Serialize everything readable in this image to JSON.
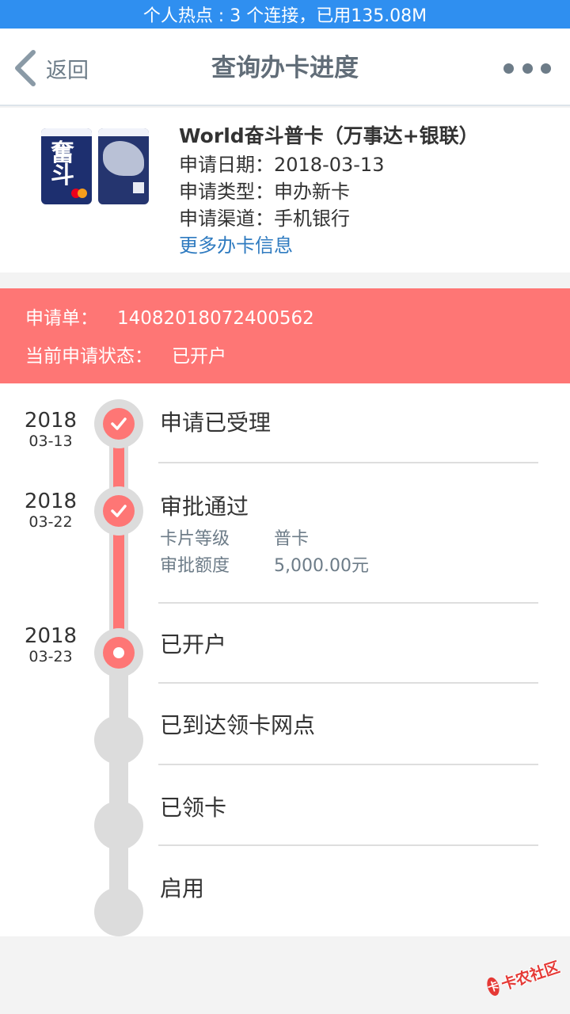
{
  "status_bar": {
    "text": "个人热点 : 3 个连接，已用135.08M"
  },
  "nav": {
    "back_label": "返回",
    "title": "查询办卡进度"
  },
  "card": {
    "name": "World奋斗普卡（万事达+银联）",
    "apply_date": "申请日期：2018-03-13",
    "apply_type": "申请类型：申办新卡",
    "apply_channel": "申请渠道：手机银行",
    "more_link": "更多办卡信息",
    "card_colors": {
      "primary": "#1d2f6f",
      "secondary": "#25356f"
    }
  },
  "application": {
    "number_label": "申请单：",
    "number_value": "14082018072400562",
    "status_label": "当前申请状态：",
    "status_value": "已开户"
  },
  "timeline": [
    {
      "year": "2018",
      "date": "03-13",
      "title": "申请已受理",
      "state": "done"
    },
    {
      "year": "2018",
      "date": "03-22",
      "title": "审批通过",
      "state": "done",
      "details": [
        {
          "label": "卡片等级",
          "value": "普卡"
        },
        {
          "label": "审批额度",
          "value": "5,000.00元"
        }
      ]
    },
    {
      "year": "2018",
      "date": "03-23",
      "title": "已开户",
      "state": "current"
    },
    {
      "title": "已到达领卡网点",
      "state": "pending"
    },
    {
      "title": "已领卡",
      "state": "pending"
    },
    {
      "title": "启用",
      "state": "pending"
    }
  ],
  "watermark": {
    "text": "卡农社区",
    "icon": "卡"
  },
  "colors": {
    "accent": "#fe7675",
    "status_bar": "#2f8ff0",
    "link": "#2f7bc0",
    "pending": "#dcdcdc"
  }
}
